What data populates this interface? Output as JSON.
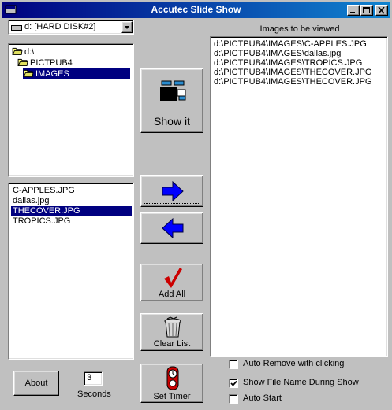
{
  "window": {
    "title": "Accutec Slide Show"
  },
  "drive": {
    "selected": "d: [HARD DISK#2]"
  },
  "directories": [
    {
      "label": "d:\\",
      "selected": false,
      "indent": 0
    },
    {
      "label": "PICTPUB4",
      "selected": false,
      "indent": 1
    },
    {
      "label": "IMAGES",
      "selected": true,
      "indent": 2
    }
  ],
  "files": [
    {
      "name": "C-APPLES.JPG",
      "selected": false
    },
    {
      "name": "dallas.jpg",
      "selected": false
    },
    {
      "name": "THECOVER.JPG",
      "selected": true
    },
    {
      "name": "TROPICS.JPG",
      "selected": false
    }
  ],
  "images_panel": {
    "label": "Images to be viewed",
    "items": [
      "d:\\PICTPUB4\\IMAGES\\C-APPLES.JPG",
      "d:\\PICTPUB4\\IMAGES\\dallas.jpg",
      "d:\\PICTPUB4\\IMAGES\\TROPICS.JPG",
      "d:\\PICTPUB4\\IMAGES\\THECOVER.JPG",
      "d:\\PICTPUB4\\IMAGES\\THECOVER.JPG"
    ]
  },
  "buttons": {
    "show_it": "Show it",
    "add_all": "Add All",
    "clear_list": "Clear List",
    "set_timer": "Set Timer",
    "about": "About"
  },
  "timer": {
    "seconds_value": "3",
    "seconds_label": "Seconds"
  },
  "options": [
    {
      "label": "Auto Remove with clicking",
      "checked": false
    },
    {
      "label": "Show File Name During Show",
      "checked": true
    },
    {
      "label": "Auto Start",
      "checked": false
    }
  ],
  "icons": {
    "title": "app-window-icon",
    "add": "right-arrow-icon",
    "remove": "left-arrow-icon",
    "add_all": "checkmark-icon",
    "clear": "trash-icon",
    "timer": "stopwatch-icon",
    "show": "slide-projector-icon"
  },
  "colors": {
    "title_bar": "#000080",
    "selection": "#000080",
    "arrow_blue": "#0000ff",
    "check_red": "#cc0000"
  }
}
